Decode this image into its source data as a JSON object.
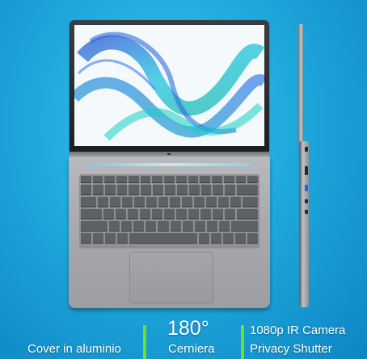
{
  "features": {
    "cover": {
      "label": "Cover in aluminio"
    },
    "hinge": {
      "value": "180°",
      "label": "Cerniera"
    },
    "camera": {
      "line1": "1080p IR Camera",
      "line2": "Privacy Shutter"
    }
  },
  "colors": {
    "background": "#1fa8dc",
    "accent_bar": "#6ee02a",
    "chassis": "#a9abae"
  }
}
